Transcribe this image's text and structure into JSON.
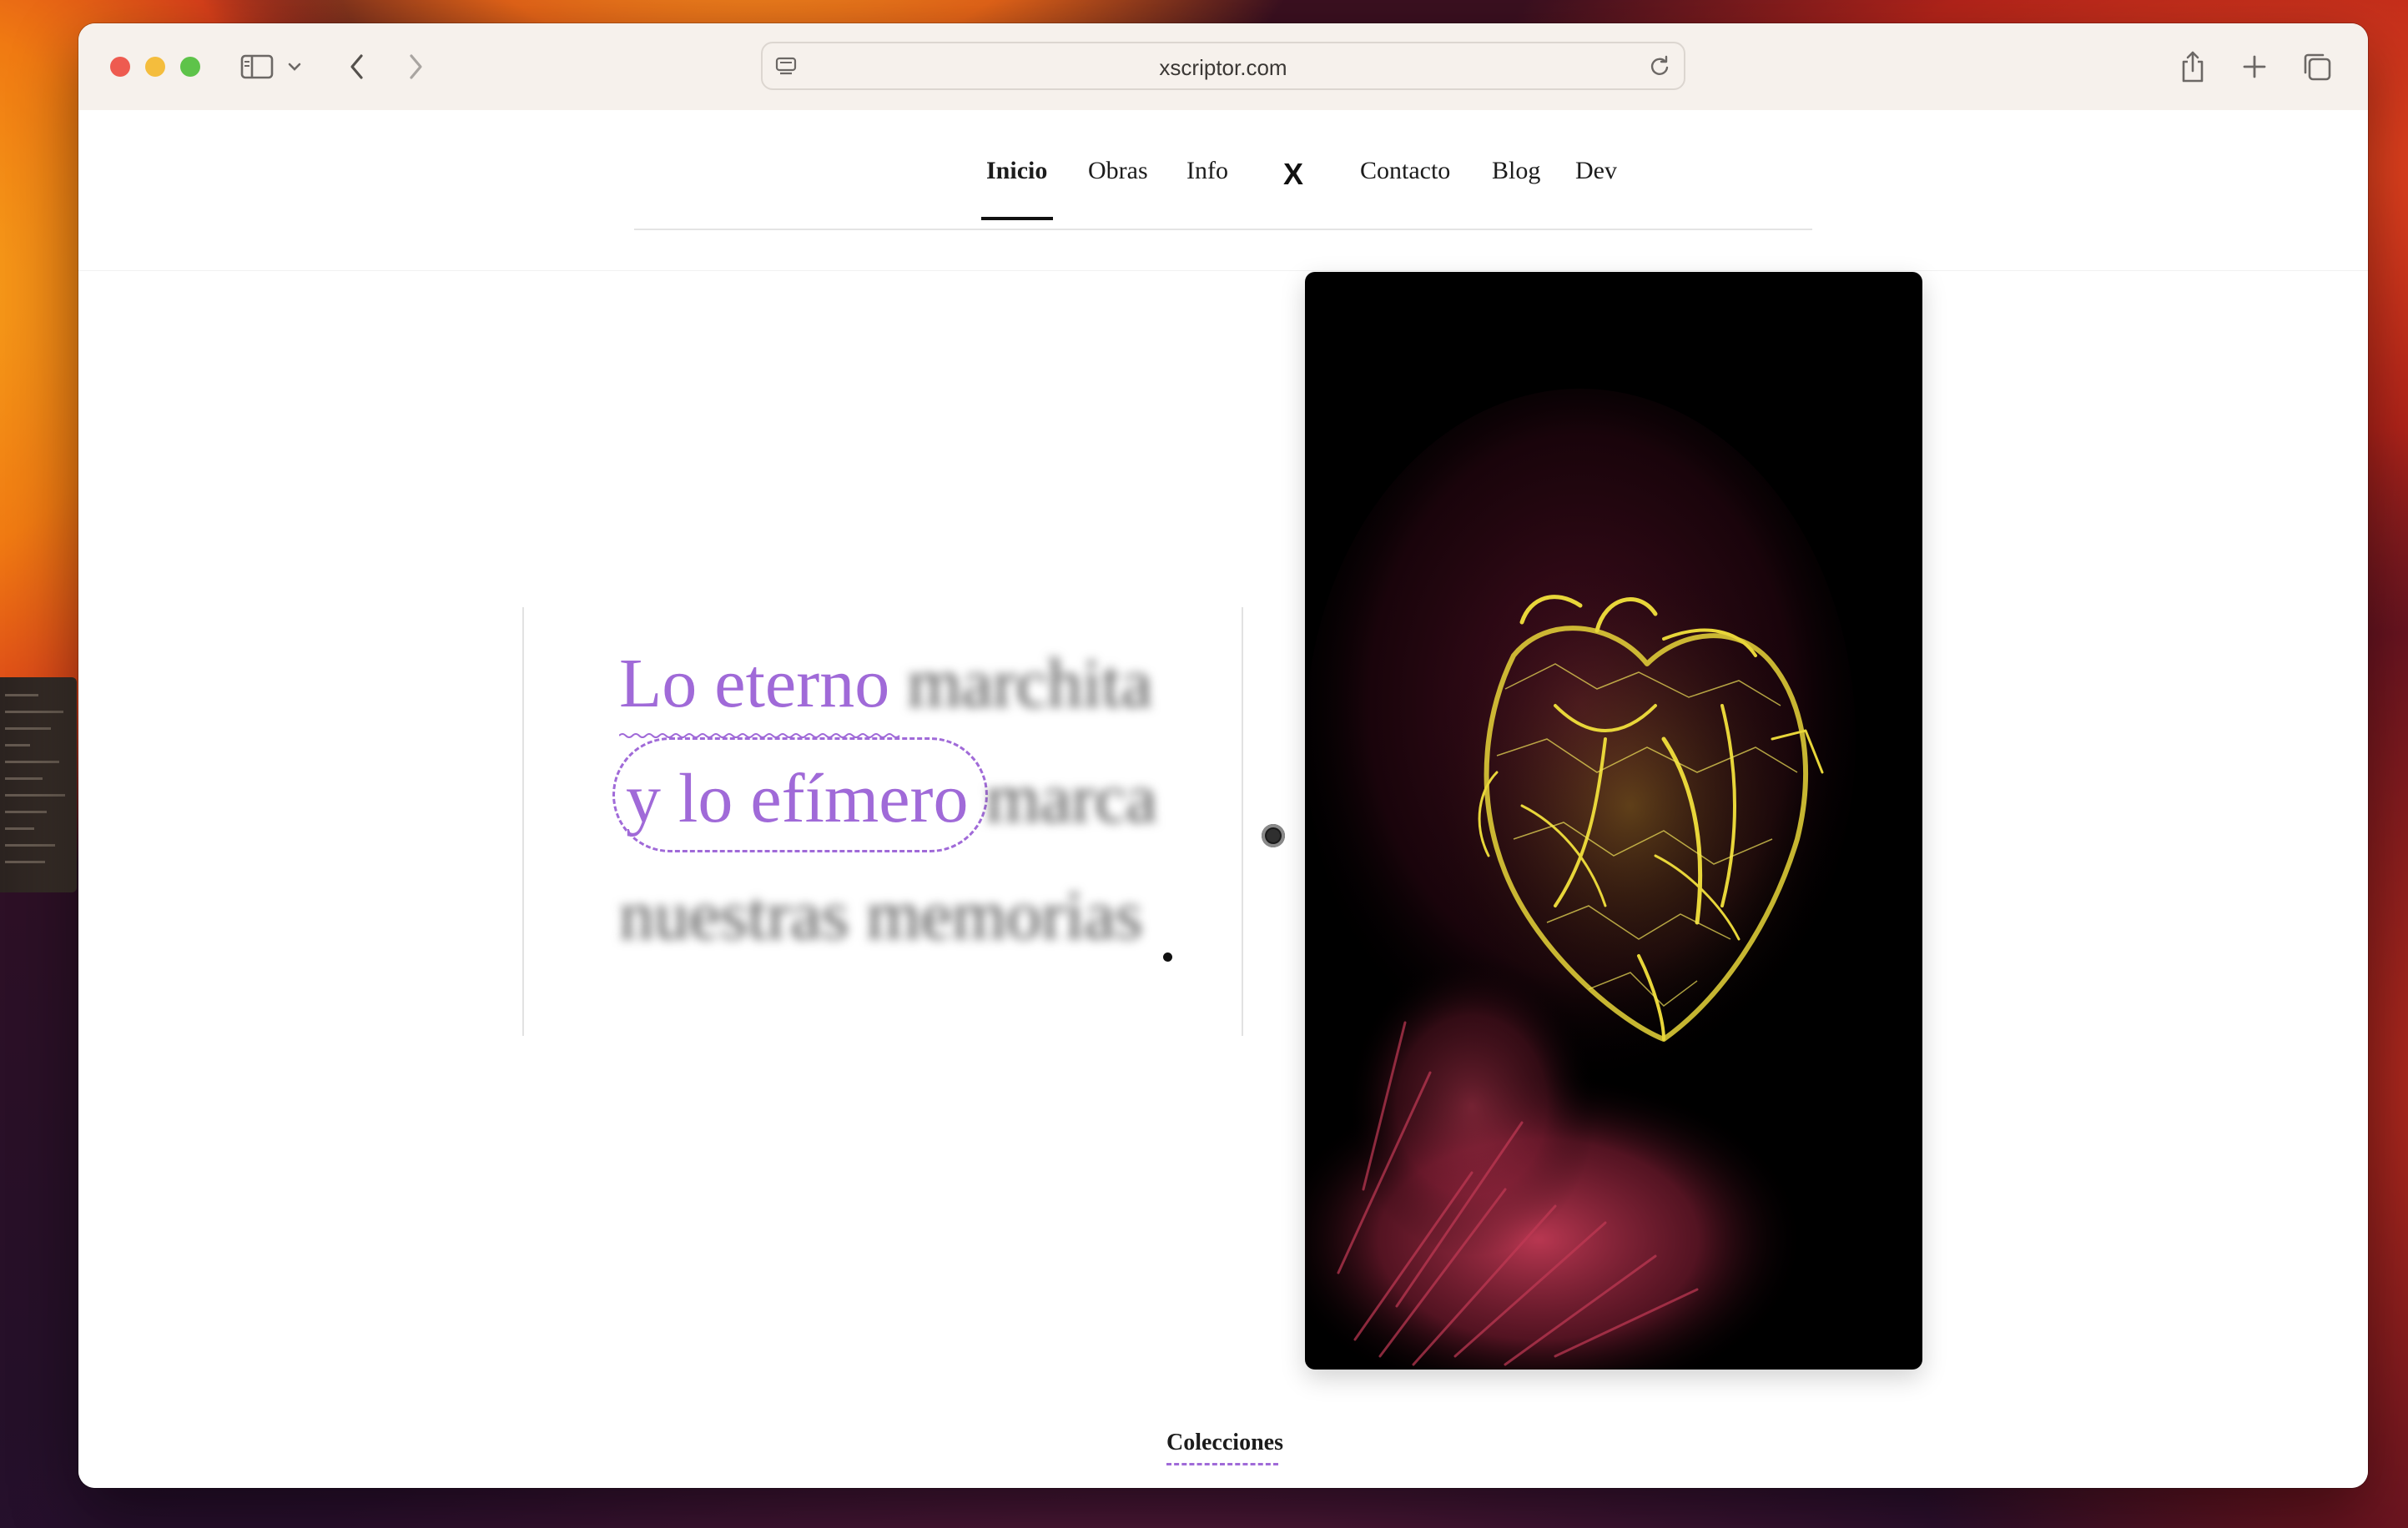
{
  "browser": {
    "url": "xscriptor.com"
  },
  "nav": {
    "items": [
      "Inicio",
      "Obras",
      "Info",
      "Contacto",
      "Blog",
      "Dev"
    ],
    "x_label": "X",
    "active": "Inicio"
  },
  "hero": {
    "line1_highlight": "Lo eterno",
    "line1_rest": "marchita",
    "line2_highlight": "y lo efímero",
    "line2_rest": "marca",
    "line3": "nuestras memorias",
    "end_mark": "."
  },
  "footer_link": "Colecciones",
  "colors": {
    "accent": "#a06ad8",
    "artwork_yellow": "#e8d63a",
    "artwork_red": "#c23a55"
  },
  "icons": [
    "sidebar-icon",
    "chevron-down-icon",
    "back-icon",
    "forward-icon",
    "site-settings-icon",
    "reload-icon",
    "share-icon",
    "plus-icon",
    "tabs-icon"
  ]
}
